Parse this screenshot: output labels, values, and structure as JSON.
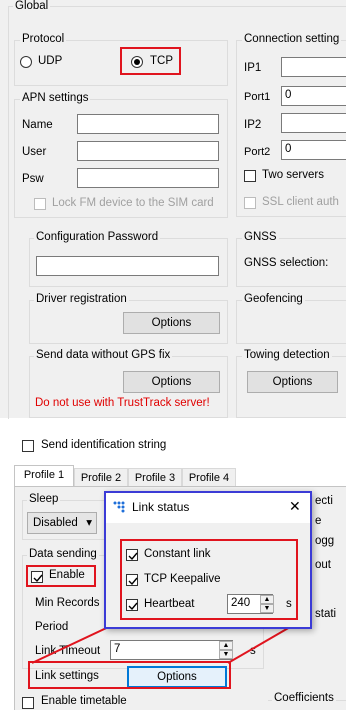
{
  "global": {
    "title": "Global",
    "protocol_label": "Protocol",
    "udp_label": "UDP",
    "tcp_label": "TCP",
    "apn_label": "APN settings",
    "name_label": "Name",
    "user_label": "User",
    "psw_label": "Psw",
    "lock_fm_label": "Lock FM device to the SIM card",
    "config_password_label": "Configuration Password",
    "driver_registration_label": "Driver registration",
    "options_label": "Options",
    "send_no_gps_label": "Send data without GPS fix",
    "warning_text": "Do not use with TrustTrack server!",
    "connection_settings_label": "Connection setting",
    "ip1_label": "IP1",
    "port1_label": "Port1",
    "port1_value": "0",
    "ip2_label": "IP2",
    "port2_label": "Port2",
    "port2_value": "0",
    "two_servers_label": "Two servers",
    "ssl_label": "SSL client auth",
    "gnss_label": "GNSS",
    "gnss_selection_label": "GNSS selection:",
    "geofencing_label": "Geofencing",
    "towing_label": "Towing detection"
  },
  "send_identification_label": "Send identification string",
  "profile_tabs": [
    "Profile 1",
    "Profile 2",
    "Profile 3",
    "Profile 4"
  ],
  "profile": {
    "sleep_label": "Sleep",
    "sleep_value": "Disabled",
    "data_sending_label": "Data sending",
    "enable_label": "Enable",
    "min_records_label": "Min Records",
    "period_label": "Period",
    "link_timeout_label": "Link Timeout",
    "link_timeout_value": "7",
    "link_timeout_unit": "s",
    "link_settings_label": "Link settings",
    "link_options_label": "Options",
    "enable_timetable_label": "Enable timetable",
    "coefficients_label": "Coefficients",
    "right_fragments": [
      "ecti",
      "e",
      "ogg",
      "out",
      "stati"
    ]
  },
  "dialog": {
    "title": "Link status",
    "close_glyph": "✕",
    "constant_link_label": "Constant link",
    "tcp_keepalive_label": "TCP Keepalive",
    "heartbeat_label": "Heartbeat",
    "heartbeat_value": "240",
    "heartbeat_unit": "s"
  },
  "icons": {
    "dialog_app_icon": "network-dots-icon",
    "check_icon": "checkmark-icon",
    "spinner_up": "▲",
    "spinner_down": "▼",
    "dropdown": "▾"
  },
  "colors": {
    "highlight_red": "#e0141e",
    "warning_red": "#e00000",
    "panel_bg": "#f0f0f0",
    "active_button_border": "#0078d7"
  }
}
